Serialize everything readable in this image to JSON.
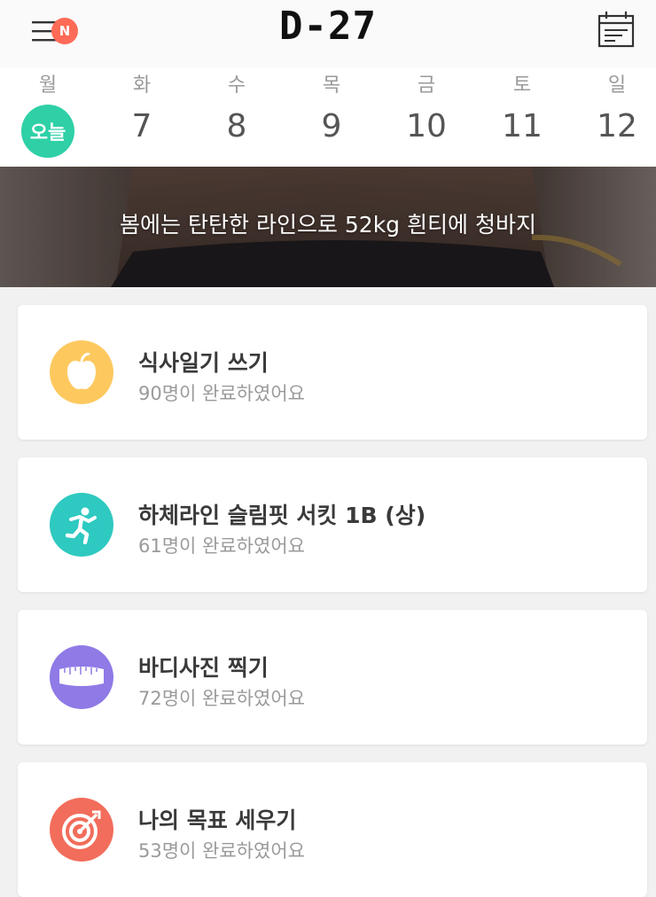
{
  "header": {
    "dday": "D-27",
    "badge": "N",
    "menu_icon": "hamburger-menu-icon",
    "calendar_icon": "calendar-list-icon"
  },
  "week": {
    "days": [
      {
        "weekday": "월",
        "date": "오늘",
        "is_today": true
      },
      {
        "weekday": "화",
        "date": "7"
      },
      {
        "weekday": "수",
        "date": "8"
      },
      {
        "weekday": "목",
        "date": "9"
      },
      {
        "weekday": "금",
        "date": "10"
      },
      {
        "weekday": "토",
        "date": "11"
      },
      {
        "weekday": "일",
        "date": "12"
      }
    ],
    "today_color": "#2fd0a6"
  },
  "banner": {
    "text": "봄에는 탄탄한 라인으로 52kg 흰티에 청바지"
  },
  "missions": [
    {
      "title": "식사일기 쓰기",
      "subtitle": "90명이 완료하였어요",
      "icon": "apple-icon",
      "color": "#fdc95f"
    },
    {
      "title": "하체라인 슬림핏 서킷 1B (상)",
      "subtitle": "61명이 완료하였어요",
      "icon": "running-person-icon",
      "color": "#2ec9c0"
    },
    {
      "title": "바디사진 찍기",
      "subtitle": "72명이 완료하였어요",
      "icon": "tape-measure-icon",
      "color": "#8f7ae6"
    },
    {
      "title": "나의 목표 세우기",
      "subtitle": "53명이 완료하였어요",
      "icon": "target-icon",
      "color": "#f26d5b"
    }
  ],
  "colors": {
    "badge": "#ff6b57",
    "background": "#f1f1f1"
  }
}
